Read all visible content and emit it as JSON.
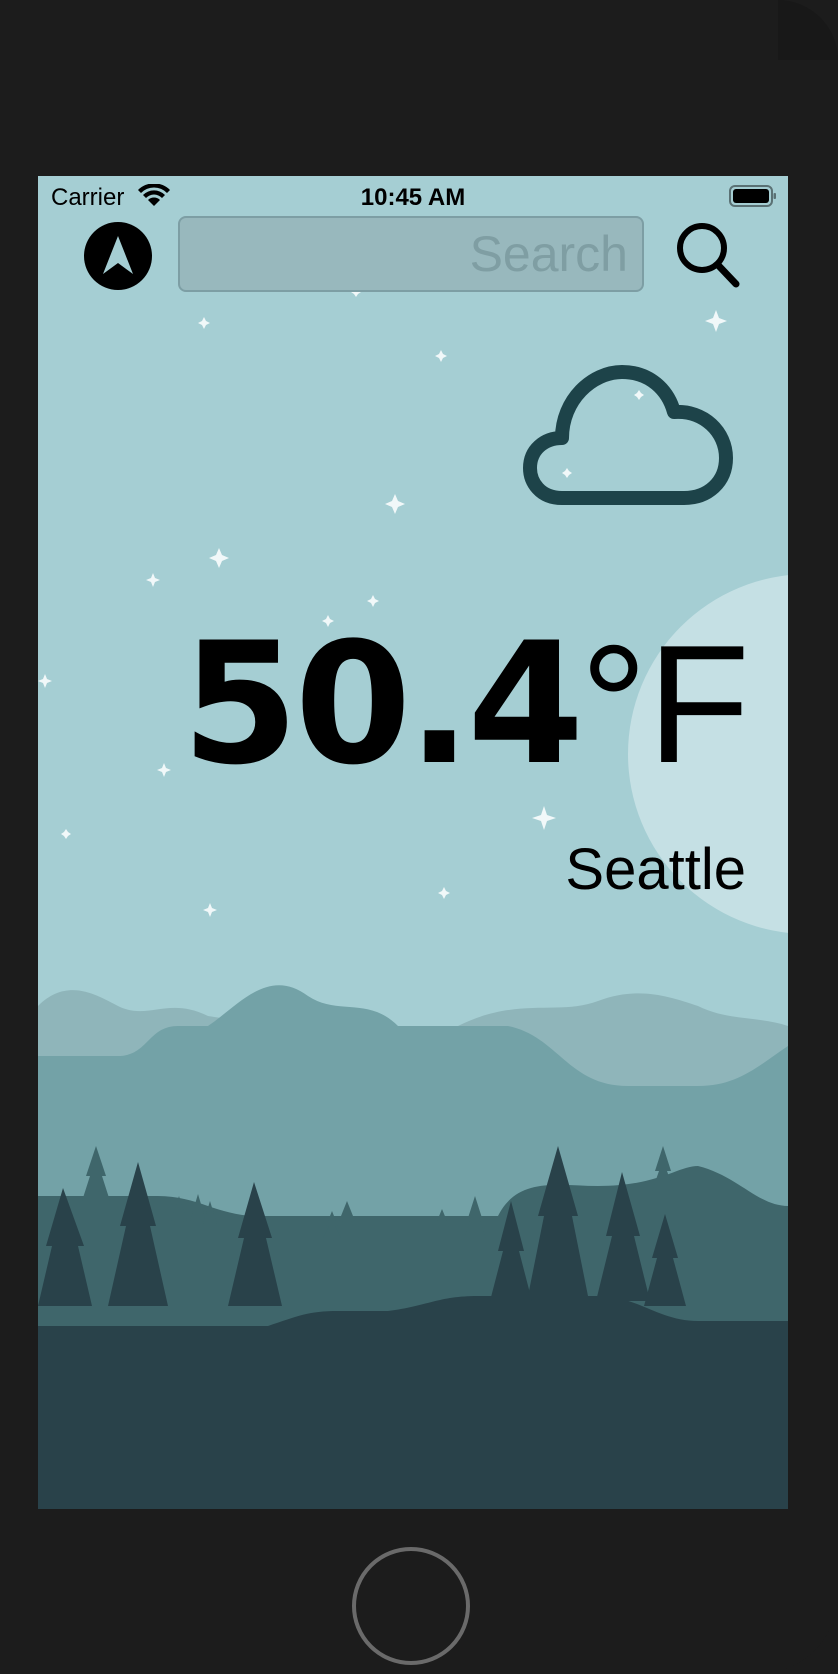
{
  "status_bar": {
    "carrier": "Carrier",
    "time": "10:45 AM",
    "wifi_icon": "wifi-icon",
    "battery_icon": "battery-full-icon"
  },
  "toolbar": {
    "location_icon": "location-arrow-icon",
    "search_placeholder": "Search",
    "search_value": "",
    "search_icon": "magnifying-glass-icon"
  },
  "weather": {
    "condition_icon": "cloud-icon",
    "temperature_value": "50.4",
    "temperature_unit": "°F",
    "city": "Seattle"
  },
  "device": {
    "home_button_icon": "home-button"
  },
  "colors": {
    "sky": "#a5ced3",
    "cloud_stroke": "#1d4349",
    "moon": "#c5e0e4",
    "hills_far": "#8fb5ba",
    "hills_mid": "#73a2a7",
    "hills_near": "#3f666b",
    "ground": "#29424a",
    "device_frame": "#1c1c1c"
  }
}
